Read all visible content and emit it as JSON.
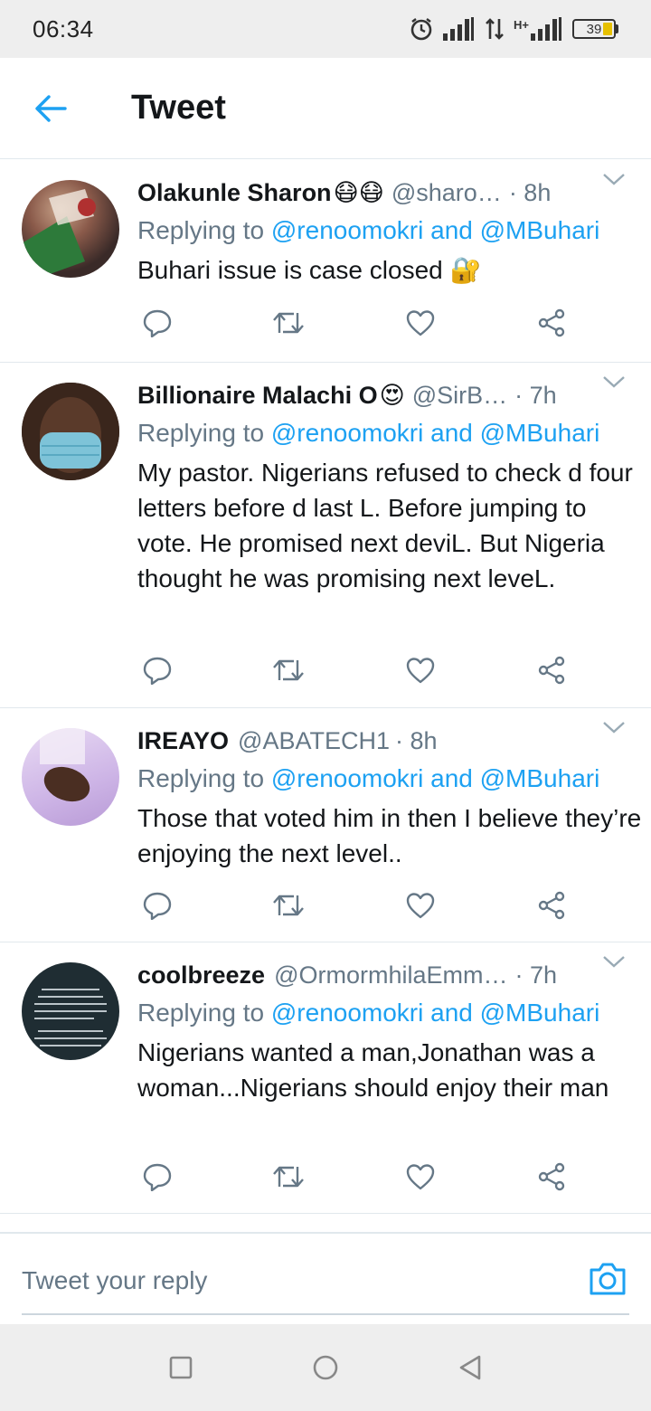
{
  "status_bar": {
    "time": "06:34",
    "network": "H+",
    "battery": "39"
  },
  "header": {
    "title": "Tweet"
  },
  "replying_label": "Replying to",
  "tweets": [
    {
      "display_name": "Olakunle Sharon",
      "name_emoji": "😷😷",
      "handle": "@sharo…",
      "time": "· 8h",
      "reply_to": "@renoomokri and @MBuhari",
      "text": "Buhari issue is case closed 🔐"
    },
    {
      "display_name": "Billionaire Malachi O",
      "name_emoji": "😍",
      "handle": "@SirB…",
      "time": "· 7h",
      "reply_to": "@renoomokri and @MBuhari",
      "text": "My pastor. Nigerians refused to check d four letters before d last L. Before jumping to vote. He promised next deviL. But Nigeria thought he was promising next leveL."
    },
    {
      "display_name": "IREAYO",
      "name_emoji": "",
      "handle": "@ABATECH1",
      "time": "· 8h",
      "reply_to": "@renoomokri and @MBuhari",
      "text": "Those that voted him in then I believe they’re enjoying the next level.."
    },
    {
      "display_name": "coolbreeze",
      "name_emoji": "",
      "handle": "@Ormormhila​Emm…",
      "time": "· 7h",
      "reply_to": "@renoomokri and @MBuhari",
      "text": "Nigerians wanted a man,Jonathan was a woman...Nigerians should enjoy their man"
    }
  ],
  "reply_bar": {
    "placeholder": "Tweet your reply"
  },
  "icons": {
    "back": "arrow-left-icon",
    "reply": "reply-icon",
    "retweet": "retweet-icon",
    "like": "heart-icon",
    "share": "share-icon",
    "camera": "camera-icon"
  },
  "colors": {
    "accent": "#1da1f2",
    "text_secondary": "#657786"
  }
}
